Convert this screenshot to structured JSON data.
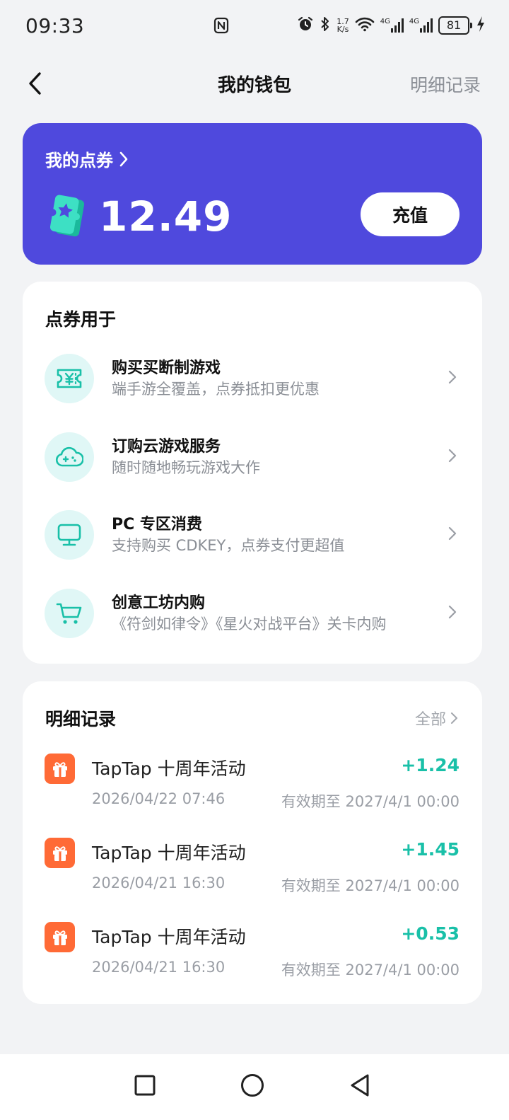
{
  "status_bar": {
    "time": "09:33",
    "network_speed_value": "1.7",
    "network_speed_unit": "K/s",
    "signal_1_label": "4G",
    "signal_2_label": "4G",
    "battery_level": "81"
  },
  "header": {
    "title": "我的钱包",
    "details_link": "明细记录"
  },
  "balance": {
    "label": "我的点券",
    "amount": "12.49",
    "recharge_label": "充值"
  },
  "uses": {
    "title": "点券用于",
    "items": [
      {
        "title": "购买买断制游戏",
        "desc": "端手游全覆盖，点券抵扣更优惠",
        "icon": "yen-ticket-icon"
      },
      {
        "title": "订购云游戏服务",
        "desc": "随时随地畅玩游戏大作",
        "icon": "cloud-gamepad-icon"
      },
      {
        "title": "PC 专区消费",
        "desc": "支持购买 CDKEY，点券支付更超值",
        "icon": "monitor-icon"
      },
      {
        "title": "创意工坊内购",
        "desc": "《符剑如律令》《星火对战平台》关卡内购",
        "icon": "cart-icon"
      }
    ]
  },
  "records": {
    "title": "明细记录",
    "all_label": "全部",
    "items": [
      {
        "title": "TapTap 十周年活动",
        "amount": "+1.24",
        "time": "2026/04/22 07:46",
        "expiry": "有效期至 2027/4/1 00:00"
      },
      {
        "title": "TapTap 十周年活动",
        "amount": "+1.45",
        "time": "2026/04/21 16:30",
        "expiry": "有效期至 2027/4/1 00:00"
      },
      {
        "title": "TapTap 十周年活动",
        "amount": "+0.53",
        "time": "2026/04/21 16:30",
        "expiry": "有效期至 2027/4/1 00:00"
      }
    ]
  },
  "colors": {
    "card_background": "#4f49dd",
    "accent_teal": "#19c0a8",
    "gift_orange": "#ff6a36",
    "page_background": "#f2f3f5"
  }
}
